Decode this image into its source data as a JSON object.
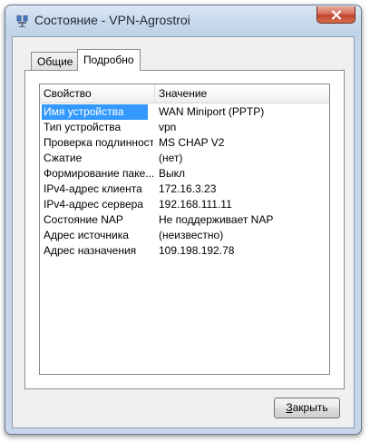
{
  "window": {
    "title": "Состояние - VPN-Agrostroi"
  },
  "tabs": [
    {
      "label": "Общие",
      "active": false
    },
    {
      "label": "Подробно",
      "active": true
    }
  ],
  "list": {
    "columns": [
      "Свойство",
      "Значение"
    ],
    "rows": [
      {
        "property": "Имя устройства",
        "value": "WAN Miniport (PPTP)",
        "selected": true
      },
      {
        "property": "Тип устройства",
        "value": "vpn"
      },
      {
        "property": "Проверка подлинности",
        "value": "MS CHAP V2"
      },
      {
        "property": "Сжатие",
        "value": "(нет)"
      },
      {
        "property": "Формирование паке...",
        "value": "Выкл"
      },
      {
        "property": "IPv4-адрес клиента",
        "value": "172.16.3.23"
      },
      {
        "property": "IPv4-адрес сервера",
        "value": "192.168.111.11"
      },
      {
        "property": "Состояние NAP",
        "value": "Не поддерживает NAP"
      },
      {
        "property": "Адрес источника",
        "value": "(неизвестно)"
      },
      {
        "property": "Адрес назначения",
        "value": "109.198.192.78"
      }
    ]
  },
  "buttons": {
    "close_accel": "З",
    "close_rest": "акрыть"
  },
  "icons": {
    "app": "network-connection-icon",
    "close": "close-icon"
  },
  "colors": {
    "selection": "#3399ff",
    "close_button": "#c2432c",
    "frame": "#c7d6e8"
  }
}
